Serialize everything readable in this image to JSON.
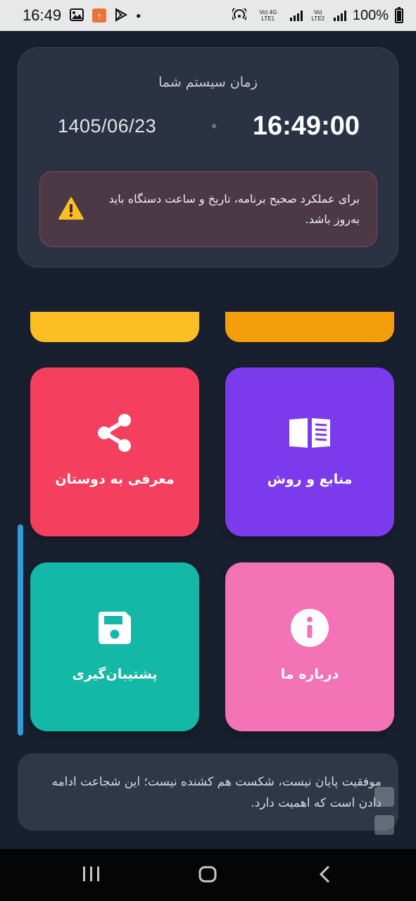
{
  "status_bar": {
    "time": "16:49",
    "network_1": "Vo) 4G LTE1",
    "network_2": "Vo) LTE2",
    "battery": "100%"
  },
  "time_card": {
    "heading": "زمان سیستم شما",
    "date": "1405/06/23",
    "clock": "16:49:00",
    "warning": "برای عملکرد صحیح برنامه، تاریخ و ساعت دستگاه باید به‌روز باشد."
  },
  "tiles": {
    "share": {
      "label": "معرفی به دوستان",
      "icon": "share-icon",
      "color": "#f43f5e"
    },
    "resources": {
      "label": "منابع و روش",
      "icon": "book-icon",
      "color": "#7c3aed"
    },
    "backup": {
      "label": "پشتیبان‌گیری",
      "icon": "floppy-disk-icon",
      "color": "#14b8a6"
    },
    "about": {
      "label": "درباره ما",
      "icon": "info-icon",
      "color": "#f472b6"
    }
  },
  "quote": "موفقیت پایان نیست، شکست هم کشنده نیست؛ این شجاعت ادامه دادن است که اهمیت دارد."
}
